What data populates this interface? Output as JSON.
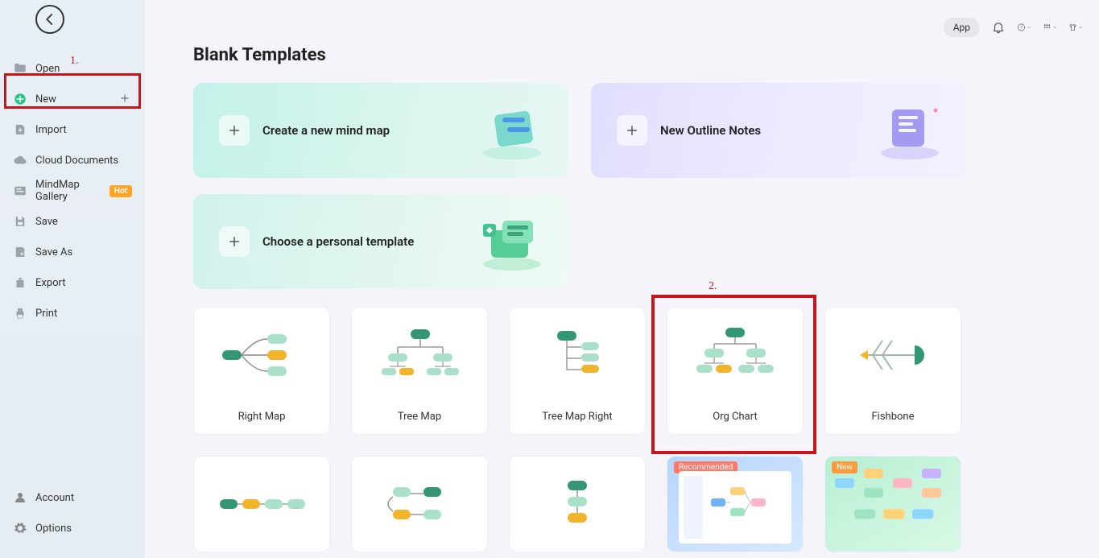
{
  "sidebar": {
    "items": [
      {
        "label": "Open",
        "icon": "folder-icon"
      },
      {
        "label": "New",
        "icon": "plus-circle-icon"
      },
      {
        "label": "Import",
        "icon": "import-icon"
      },
      {
        "label": "Cloud Documents",
        "icon": "cloud-icon"
      },
      {
        "label": "MindMap Gallery",
        "icon": "gallery-icon",
        "badge": "Hot"
      },
      {
        "label": "Save",
        "icon": "save-icon"
      },
      {
        "label": "Save As",
        "icon": "save-as-icon"
      },
      {
        "label": "Export",
        "icon": "export-icon"
      },
      {
        "label": "Print",
        "icon": "print-icon"
      }
    ],
    "bottom": [
      {
        "label": "Account",
        "icon": "account-icon"
      },
      {
        "label": "Options",
        "icon": "gear-icon"
      }
    ]
  },
  "topbar": {
    "app_label": "App"
  },
  "section_title": "Blank Templates",
  "big_cards": {
    "mindmap": "Create a new mind map",
    "outline": "New Outline Notes",
    "personal": "Choose a personal template"
  },
  "templates": [
    {
      "label": "Right Map"
    },
    {
      "label": "Tree Map"
    },
    {
      "label": "Tree Map Right"
    },
    {
      "label": "Org Chart"
    },
    {
      "label": "Fishbone"
    }
  ],
  "badges": {
    "recommended": "Recommended",
    "new": "New"
  },
  "annotations": {
    "one": "1.",
    "two": "2."
  }
}
